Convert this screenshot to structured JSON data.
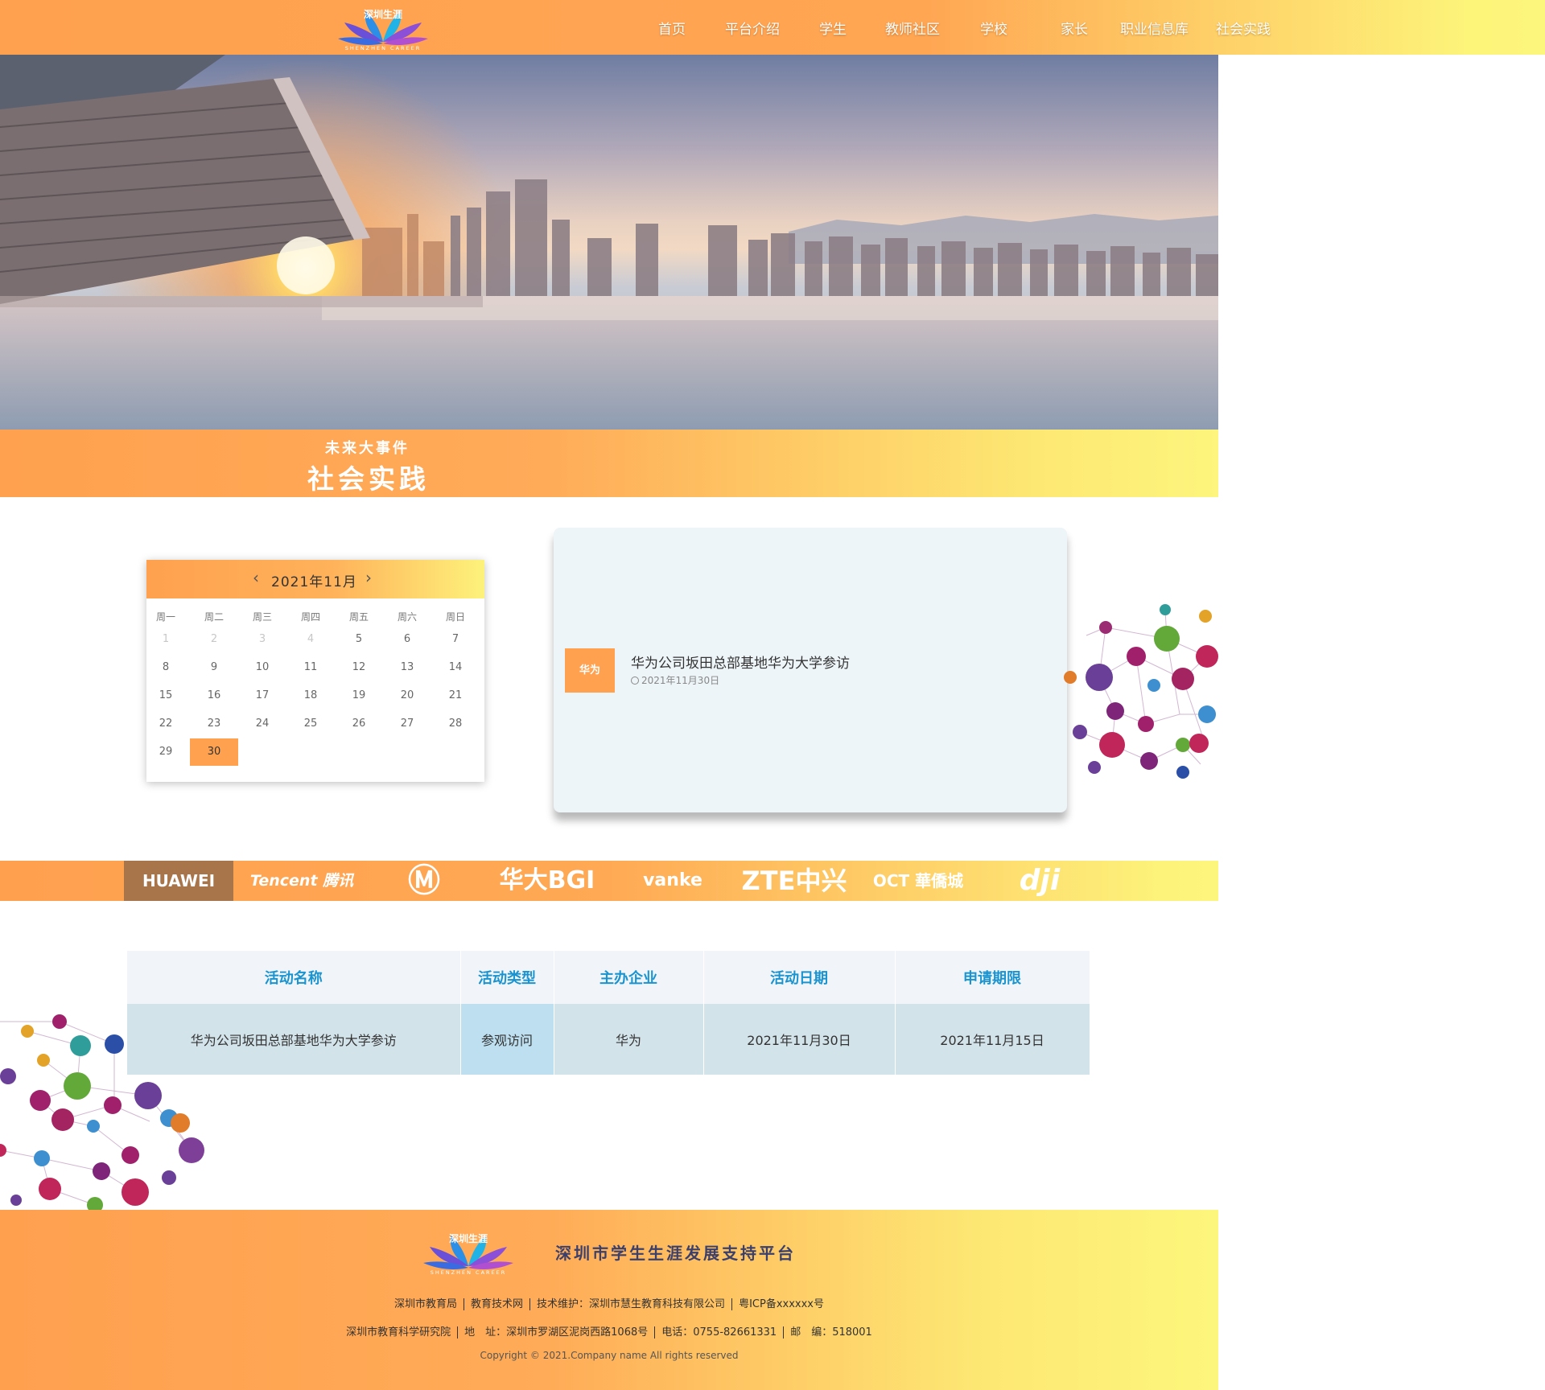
{
  "header": {
    "logo_text_cn": "深圳生涯",
    "logo_text_en": "SHENZHEN CAREER",
    "nav": [
      "首页",
      "平台介绍",
      "学生",
      "教师社区",
      "学校",
      "家长",
      "职业信息库",
      "社会实践"
    ]
  },
  "band": {
    "subtitle": "未来大事件",
    "title": "社会实践"
  },
  "calendar": {
    "month_label": "2021年11月",
    "weekdays": [
      "周一",
      "周二",
      "周三",
      "周四",
      "周五",
      "周六",
      "周日"
    ],
    "days": [
      1,
      2,
      3,
      4,
      5,
      6,
      7,
      8,
      9,
      10,
      11,
      12,
      13,
      14,
      15,
      16,
      17,
      18,
      19,
      20,
      21,
      22,
      23,
      24,
      25,
      26,
      27,
      28,
      29,
      30
    ],
    "selected_day": 30,
    "muted_days": [
      1,
      2,
      3,
      4
    ]
  },
  "event": {
    "tag": "华为",
    "title": "华为公司坂田总部基地华为大学参访",
    "date": "2021年11月30日"
  },
  "partners": [
    "HUAWEI",
    "Tencent 腾讯",
    "Ⓜ",
    "华大BGI",
    "vanke",
    "ZTE中兴",
    "OCT 華僑城",
    "dji"
  ],
  "table": {
    "headers": [
      "活动名称",
      "活动类型",
      "主办企业",
      "活动日期",
      "申请期限"
    ],
    "rows": [
      [
        "华为公司坂田总部基地华为大学参访",
        "参观访问",
        "华为",
        "2021年11月30日",
        "2021年11月15日"
      ]
    ]
  },
  "footer": {
    "platform_name": "深圳市学生生涯发展支持平台",
    "row1": [
      "深圳市教育局",
      "教育技术网",
      "技术维护：深圳市慧生教育科技有限公司",
      "粤ICP备xxxxxx号"
    ],
    "row2": [
      "深圳市教育科学研究院",
      "地　址：深圳市罗湖区泥岗西路1068号",
      "电话：0755-82661331",
      "邮　编：518001"
    ],
    "copyright": "Copyright © 2021.Company name All rights reserved"
  },
  "colors": {
    "accent": "#ffa14f",
    "yellow": "#fdf67c",
    "table_header_text": "#1a93cf",
    "table_row_bg": "#d3e3ea"
  }
}
